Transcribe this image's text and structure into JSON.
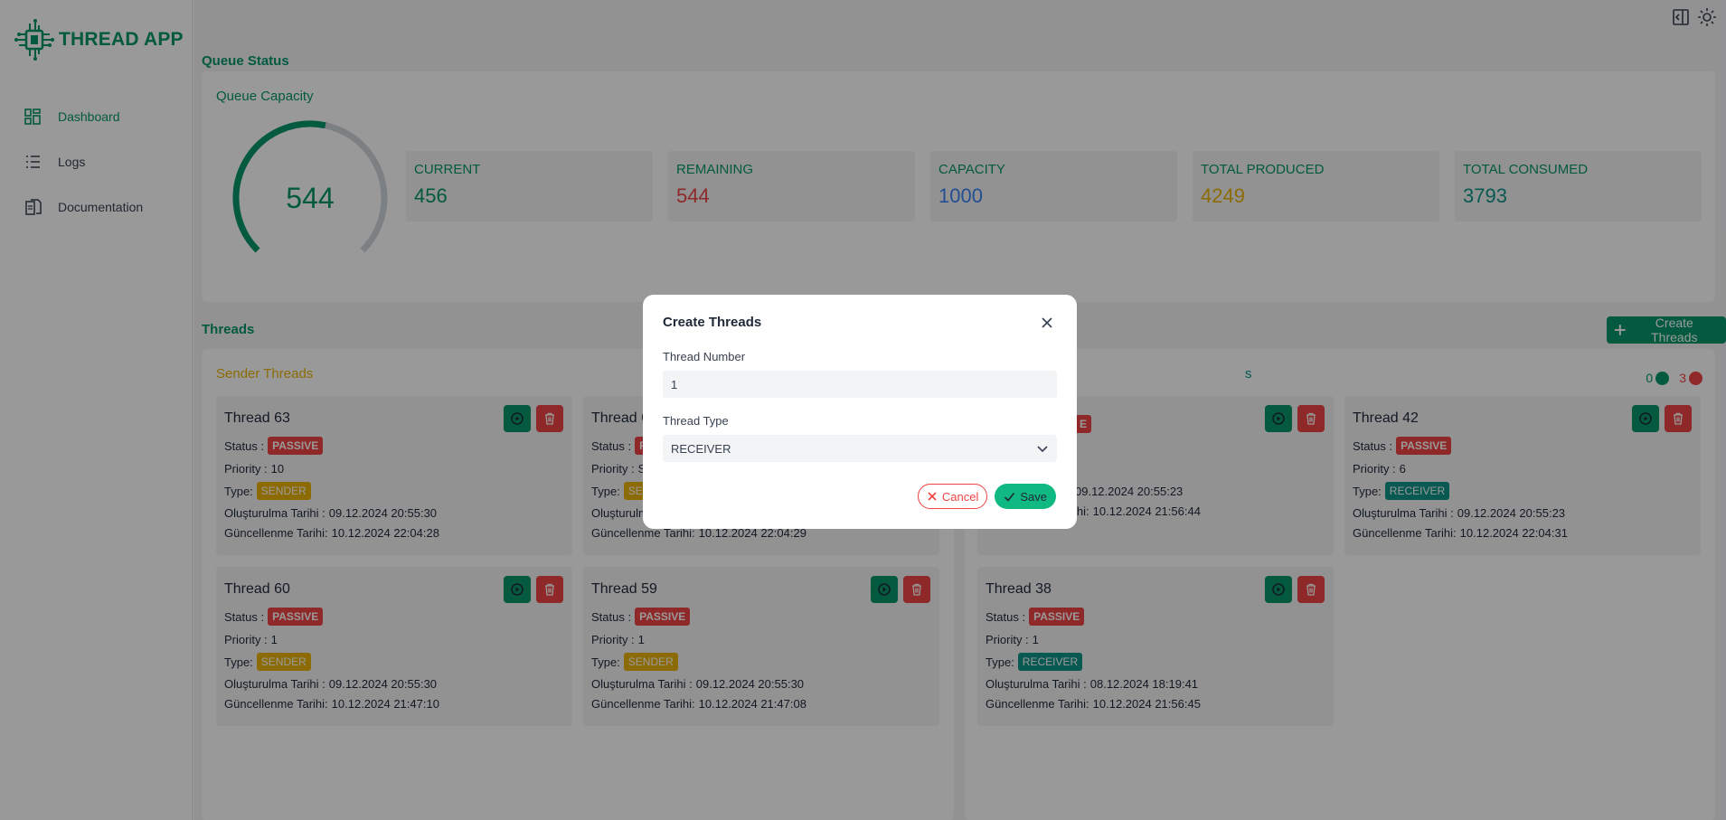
{
  "app": {
    "name": "THREAD APP",
    "accent": "#059669"
  },
  "sidebar": {
    "items": [
      {
        "label": "Dashboard",
        "icon": "dashboard-grid-icon"
      },
      {
        "label": "Logs",
        "icon": "list-icon"
      },
      {
        "label": "Documentation",
        "icon": "document-icon"
      }
    ]
  },
  "topbar": {
    "icons": [
      "collapse-sidebar-icon",
      "theme-sun-icon"
    ]
  },
  "queue": {
    "section_title": "Queue Status",
    "panel_title": "Queue Capacity",
    "gauge_value": "544",
    "gauge_fraction": 0.544,
    "stats": [
      {
        "label": "CURRENT",
        "value": "456",
        "color": "#059669"
      },
      {
        "label": "REMAINING",
        "value": "544",
        "color": "#ef4444"
      },
      {
        "label": "CAPACITY",
        "value": "1000",
        "color": "#3b82f6"
      },
      {
        "label": "TOTAL PRODUCED",
        "value": "4249",
        "color": "#eab308"
      },
      {
        "label": "TOTAL CONSUMED",
        "value": "3793",
        "color": "#0d9488"
      }
    ]
  },
  "threads": {
    "section_title": "Threads",
    "create_label": "Create Threads",
    "sender_title": "Sender Threads",
    "receiver_title_visible": "s",
    "receiver_counts": {
      "active": "0",
      "passive": "3"
    },
    "status_label": "Status :",
    "priority_label": "Priority :",
    "type_label": "Type:",
    "created_label": "Oluşturulma Tarihi :",
    "updated_label": "Güncellenme Tarihi:",
    "sender": [
      {
        "name": "Thread 63",
        "status": "PASSIVE",
        "priority": "10",
        "type": "SENDER",
        "created": "09.12.2024 20:55:30",
        "updated": "10.12.2024 22:04:28"
      },
      {
        "name": "Thread 6",
        "status": "P",
        "priority": "S",
        "type": "SE",
        "created": "",
        "updated": "10.12.2024 22:04:29"
      },
      {
        "name": "Thread 60",
        "status": "PASSIVE",
        "priority": "1",
        "type": "SENDER",
        "created": "09.12.2024 20:55:30",
        "updated": "10.12.2024 21:47:10"
      },
      {
        "name": "Thread 59",
        "status": "PASSIVE",
        "priority": "1",
        "type": "SENDER",
        "created": "09.12.2024 20:55:30",
        "updated": "10.12.2024 21:47:08"
      }
    ],
    "receiver": [
      {
        "name": "",
        "status": "E",
        "priority": "",
        "type": "",
        "created": "09.12.2024 20:55:23",
        "updated": "10.12.2024 21:56:44"
      },
      {
        "name": "Thread 42",
        "status": "PASSIVE",
        "priority": "6",
        "type": "RECEIVER",
        "created": "09.12.2024 20:55:23",
        "updated": "10.12.2024 22:04:31"
      },
      {
        "name": "Thread 38",
        "status": "PASSIVE",
        "priority": "1",
        "type": "RECEIVER",
        "created": "08.12.2024 18:19:41",
        "updated": "10.12.2024 21:56:45"
      }
    ]
  },
  "dialog": {
    "title": "Create Threads",
    "number_label": "Thread Number",
    "number_value": "1",
    "type_label": "Thread Type",
    "type_value": "RECEIVER",
    "cancel_label": "Cancel",
    "save_label": "Save"
  }
}
